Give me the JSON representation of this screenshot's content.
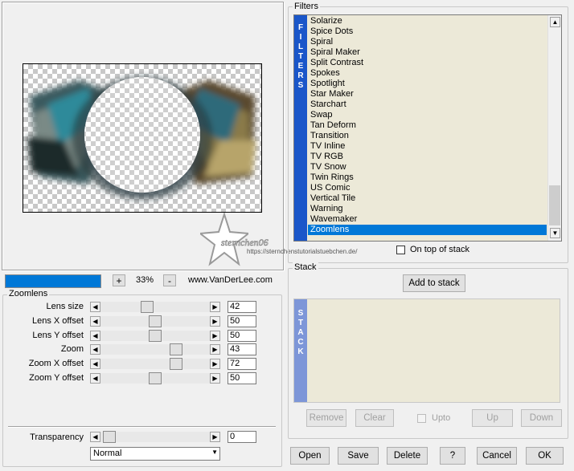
{
  "preview": {
    "zoom_minus_label": "-",
    "zoom_plus_label": "+",
    "zoom_value": "33%",
    "website": "www.VanDerLee.com",
    "progress_percent": 100,
    "watermark_name": "sternchen06",
    "watermark_url": "https://sternchenstutorialstuebchen.de/"
  },
  "filters": {
    "title": "Filters",
    "strip_label": "FILTERS",
    "items": [
      "Solarize",
      "Spice Dots",
      "Spiral",
      "Spiral Maker",
      "Split Contrast",
      "Spokes",
      "Spotlight",
      "Star Maker",
      "Starchart",
      "Swap",
      "Tan Deform",
      "Transition",
      "TV Inline",
      "TV RGB",
      "TV Snow",
      "Twin Rings",
      "US Comic",
      "Vertical Tile",
      "Warning",
      "Wavemaker",
      "Zoomlens"
    ],
    "selected": "Zoomlens",
    "on_top_label": "On top of stack"
  },
  "zoomlens": {
    "title": "Zoomlens",
    "params": [
      {
        "label": "Lens size",
        "value": "42",
        "pos": 0.42
      },
      {
        "label": "Lens X offset",
        "value": "50",
        "pos": 0.5
      },
      {
        "label": "Lens Y offset",
        "value": "50",
        "pos": 0.5
      },
      {
        "label": "Zoom",
        "value": "43",
        "pos": 0.72
      },
      {
        "label": "Zoom X offset",
        "value": "72",
        "pos": 0.72
      },
      {
        "label": "Zoom Y offset",
        "value": "50",
        "pos": 0.5
      }
    ],
    "transparency_label": "Transparency",
    "transparency_value": "0",
    "blend_mode": "Normal"
  },
  "stack": {
    "title": "Stack",
    "add_label": "Add to stack",
    "strip_label": "STACK",
    "remove_label": "Remove",
    "clear_label": "Clear",
    "upto_label": "Upto",
    "up_label": "Up",
    "down_label": "Down"
  },
  "footer": {
    "open": "Open",
    "save": "Save",
    "delete": "Delete",
    "help": "?",
    "cancel": "Cancel",
    "ok": "OK"
  },
  "colors": {
    "accent": "#0078d7",
    "strip": "#1a56c9",
    "stack_strip": "#7d96d8",
    "list_bg": "#ece9d8"
  }
}
